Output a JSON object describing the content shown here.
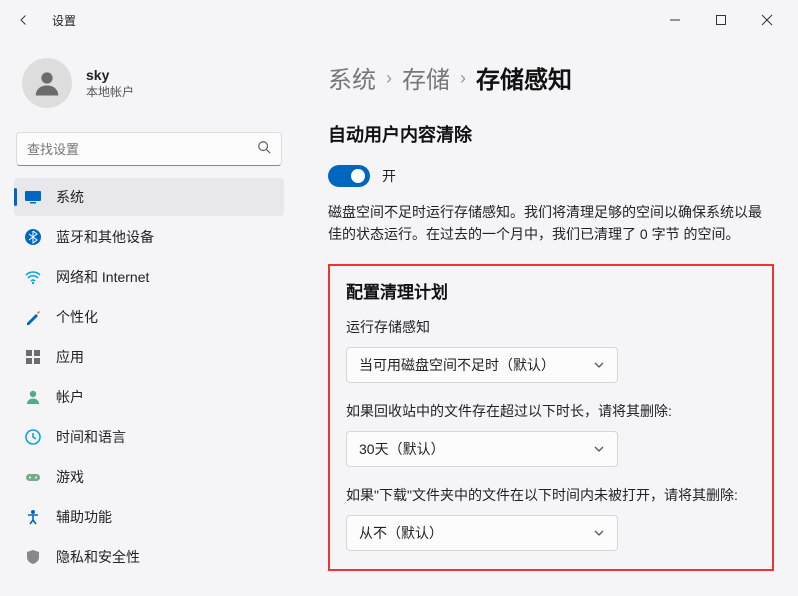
{
  "window": {
    "title": "设置"
  },
  "user": {
    "name": "sky",
    "sub": "本地帐户"
  },
  "search": {
    "placeholder": "查找设置"
  },
  "sidebar": {
    "items": [
      {
        "label": "系统"
      },
      {
        "label": "蓝牙和其他设备"
      },
      {
        "label": "网络和 Internet"
      },
      {
        "label": "个性化"
      },
      {
        "label": "应用"
      },
      {
        "label": "帐户"
      },
      {
        "label": "时间和语言"
      },
      {
        "label": "游戏"
      },
      {
        "label": "辅助功能"
      },
      {
        "label": "隐私和安全性"
      }
    ]
  },
  "breadcrumb": {
    "items": [
      "系统",
      "存储"
    ],
    "current": "存储感知"
  },
  "section": {
    "title": "自动用户内容清除",
    "toggle_label": "开",
    "desc": "磁盘空间不足时运行存储感知。我们将清理足够的空间以确保系统以最佳的状态运行。在过去的一个月中，我们已清理了 0 字节 的空间。"
  },
  "config": {
    "title": "配置清理计划",
    "fields": [
      {
        "label": "运行存储感知",
        "value": "当可用磁盘空间不足时（默认）"
      },
      {
        "label": "如果回收站中的文件存在超过以下时长，请将其删除:",
        "value": "30天（默认）"
      },
      {
        "label": "如果\"下载\"文件夹中的文件在以下时间内未被打开，请将其删除:",
        "value": "从不（默认）"
      }
    ]
  }
}
